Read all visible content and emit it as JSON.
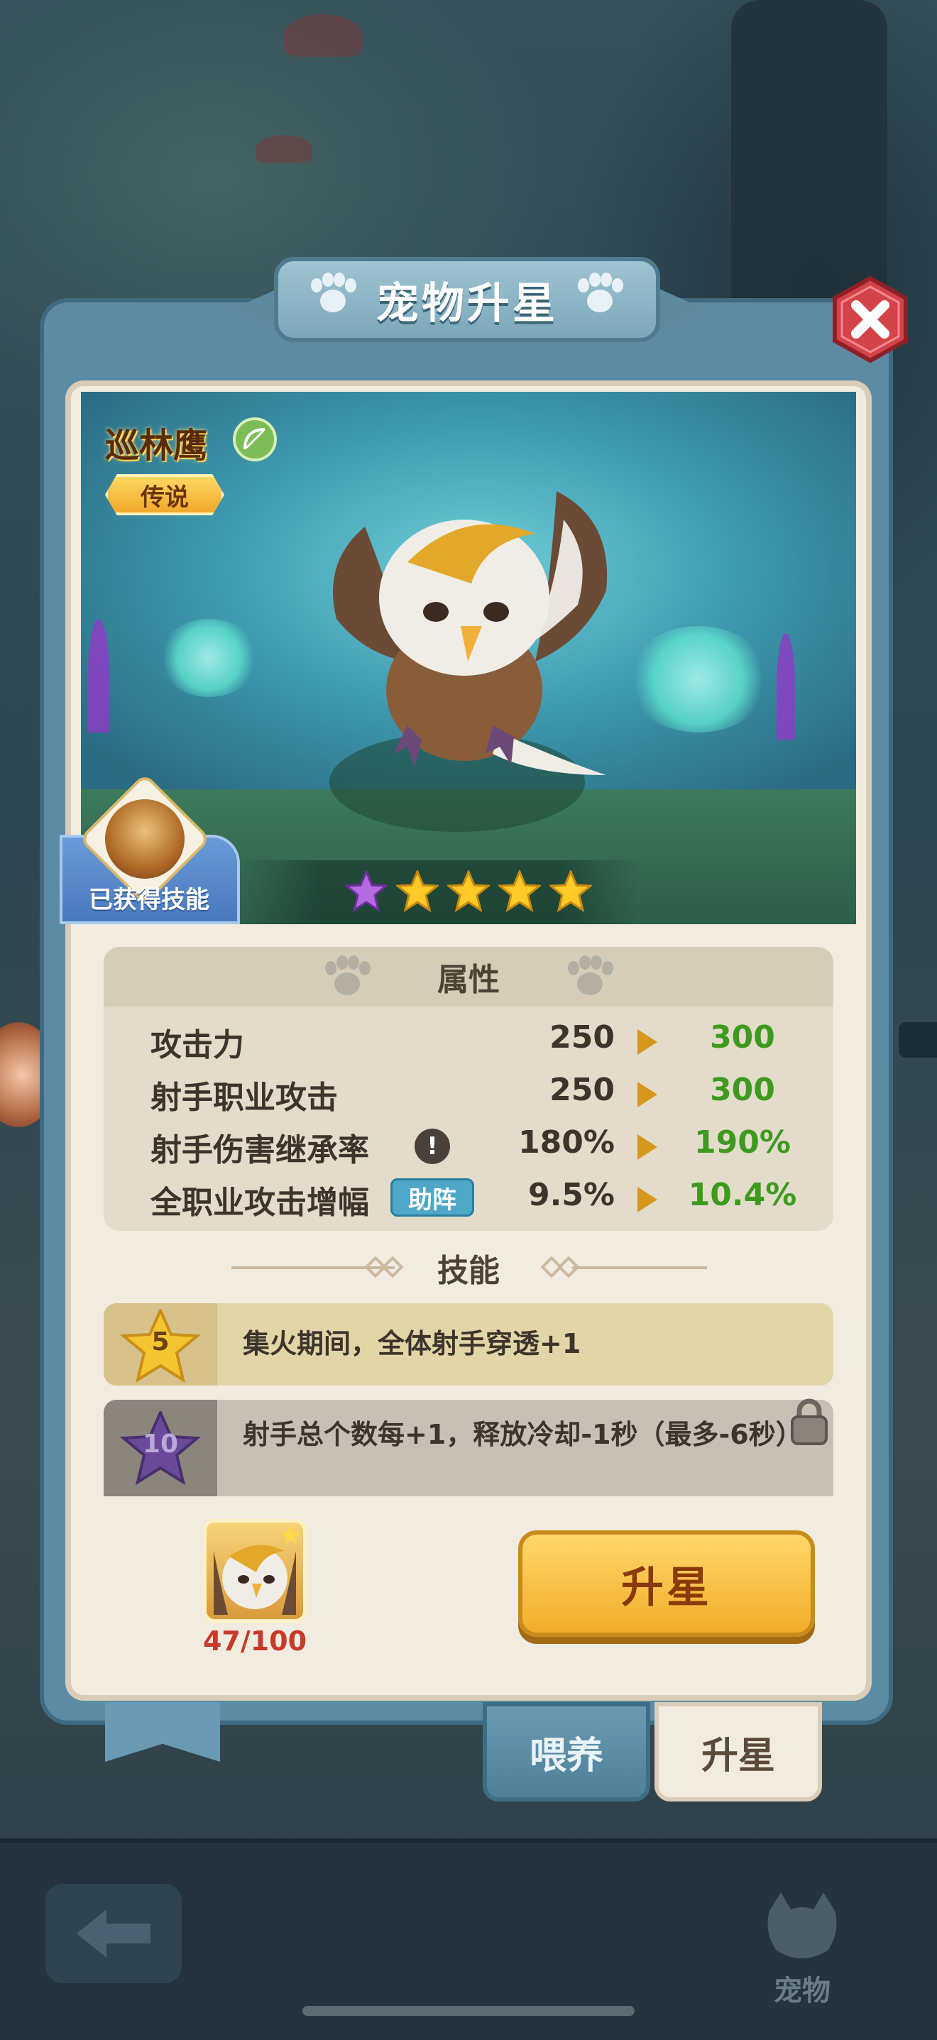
{
  "title": "宠物升星",
  "pet": {
    "name": "巡林鹰",
    "rarity": "传说",
    "skill_obtained_label": "已获得技能",
    "stars": [
      "purple",
      "gold",
      "gold",
      "gold",
      "gold"
    ]
  },
  "attributes": {
    "title": "属性",
    "rows": [
      {
        "label": "攻击力",
        "old": "250",
        "new": "300",
        "tag": "",
        "info": false
      },
      {
        "label": "射手职业攻击",
        "old": "250",
        "new": "300",
        "tag": "",
        "info": false
      },
      {
        "label": "射手伤害继承率",
        "old": "180%",
        "new": "190%",
        "tag": "",
        "info": true
      },
      {
        "label": "全职业攻击增幅",
        "old": "9.5%",
        "new": "10.4%",
        "tag": "助阵",
        "info": false
      }
    ]
  },
  "skills": {
    "title": "技能",
    "items": [
      {
        "star": "5",
        "text": "集火期间，全体射手穿透+1",
        "locked": false
      },
      {
        "star": "10",
        "text": "射手总个数每+1，释放冷却-1秒（最多-6秒）",
        "locked": true
      }
    ]
  },
  "material": {
    "count": "47/100"
  },
  "upgrade_button": "升星",
  "tabs": {
    "feed": "喂养",
    "upstar": "升星"
  },
  "nav": {
    "pet_label": "宠物"
  },
  "colors": {
    "accent_green": "#3d9a1e",
    "button_gold": "#f2ad2a",
    "panel_blue": "#5d8ba3"
  }
}
